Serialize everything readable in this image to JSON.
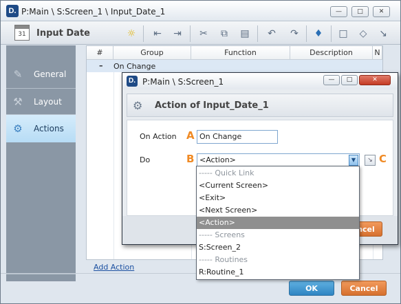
{
  "window": {
    "title": "P:Main \\ S:Screen_1 \\ Input_Date_1",
    "app_icon": "D."
  },
  "toolbar": {
    "title": "Input Date",
    "calendar_day": "31"
  },
  "sidebar": {
    "items": [
      {
        "label": "General"
      },
      {
        "label": "Layout"
      },
      {
        "label": "Actions"
      }
    ]
  },
  "table": {
    "columns": [
      "#",
      "Group",
      "Function",
      "Description",
      "N"
    ],
    "rows": [
      {
        "group": "On Change"
      }
    ]
  },
  "add_action_label": "Add Action",
  "footer": {
    "ok_label": "OK",
    "cancel_label": "Cancel"
  },
  "dialog": {
    "title": "P:Main \\ S:Screen_1",
    "header": "Action of Input_Date_1",
    "on_action_label": "On Action",
    "on_action_value": "On Change",
    "do_label": "Do",
    "do_value": "<Action>",
    "marker_a": "A",
    "marker_b": "B",
    "marker_c": "C",
    "cancel_partial": "ncel"
  },
  "dropdown": {
    "options": [
      {
        "label": "----- Quick Link",
        "type": "group"
      },
      {
        "label": "<Current Screen>",
        "type": "item"
      },
      {
        "label": "<Exit>",
        "type": "item"
      },
      {
        "label": "<Next Screen>",
        "type": "item"
      },
      {
        "label": "<Action>",
        "type": "selected"
      },
      {
        "label": "----- Screens",
        "type": "group"
      },
      {
        "label": "S:Screen_2",
        "type": "item"
      },
      {
        "label": "----- Routines",
        "type": "group"
      },
      {
        "label": "R:Routine_1",
        "type": "item"
      }
    ]
  },
  "colors": {
    "accent_orange": "#f08a24",
    "ok_blue": "#2f85c2",
    "cancel_orange": "#d6702e",
    "nav_active": "#b7dcf5"
  }
}
